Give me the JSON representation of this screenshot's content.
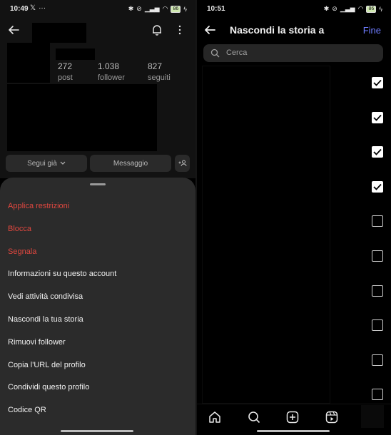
{
  "left": {
    "status": {
      "time": "10:49",
      "battery": "86"
    },
    "stats": [
      {
        "value": "272",
        "label": "post"
      },
      {
        "value": "1.038",
        "label": "follower"
      },
      {
        "value": "827",
        "label": "seguiti"
      }
    ],
    "buttons": {
      "follow": "Segui già",
      "message": "Messaggio"
    },
    "menu": [
      {
        "label": "Applica restrizioni",
        "danger": true
      },
      {
        "label": "Blocca",
        "danger": true
      },
      {
        "label": "Segnala",
        "danger": true
      },
      {
        "label": "Informazioni su questo account",
        "danger": false
      },
      {
        "label": "Vedi attività condivisa",
        "danger": false
      },
      {
        "label": "Nascondi la tua storia",
        "danger": false
      },
      {
        "label": "Rimuovi follower",
        "danger": false
      },
      {
        "label": "Copia l'URL del profilo",
        "danger": false
      },
      {
        "label": "Condividi questo profilo",
        "danger": false
      },
      {
        "label": "Codice QR",
        "danger": false
      }
    ]
  },
  "right": {
    "status": {
      "time": "10:51",
      "battery": "86"
    },
    "title": "Nascondi la storia a",
    "done_label": "Fine",
    "search_placeholder": "Cerca",
    "checkboxes": [
      true,
      true,
      true,
      true,
      false,
      false,
      false,
      false,
      false,
      false
    ]
  },
  "colors": {
    "danger": "#e0473f",
    "accent": "#6e7cff",
    "sheet": "#2b2b2b"
  },
  "icons": [
    "back-arrow-icon",
    "bell-icon",
    "kebab-icon",
    "chevron-down-icon",
    "add-person-icon",
    "search-icon",
    "checkmark-icon",
    "home-icon",
    "plus-square-icon",
    "reels-icon"
  ]
}
